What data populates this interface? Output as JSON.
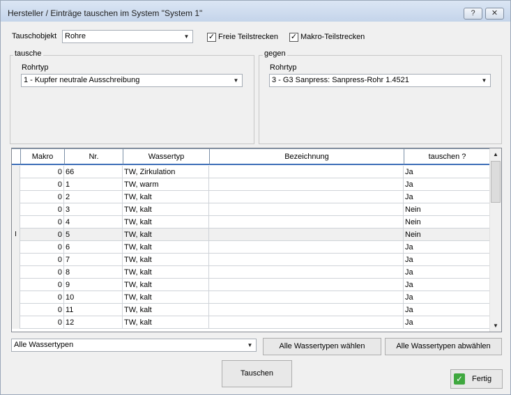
{
  "window": {
    "title": "Hersteller / Einträge tauschen im System \"System 1\"",
    "help_label": "?",
    "close_label": "✕"
  },
  "tauschobjekt": {
    "label": "Tauschobjekt",
    "value": "Rohre",
    "freie_label": "Freie Teilstrecken",
    "freie_checked": true,
    "makro_label": "Makro-Teilstrecken",
    "makro_checked": true
  },
  "tausche": {
    "legend": "tausche",
    "rohrtyp_label": "Rohrtyp",
    "rohrtyp_value": "1 - Kupfer neutrale Ausschreibung"
  },
  "gegen": {
    "legend": "gegen",
    "rohrtyp_label": "Rohrtyp",
    "rohrtyp_value": "3 - G3 Sanpress:  Sanpress-Rohr 1.4521"
  },
  "grid": {
    "columns": [
      "Makro",
      "Nr.",
      "Wassertyp",
      "Bezeichnung",
      "tauschen ?"
    ],
    "rows": [
      {
        "makro": "0",
        "nr": "66",
        "wassertyp": "TW, Zirkulation",
        "bezeichnung": "",
        "tauschen": "Ja"
      },
      {
        "makro": "0",
        "nr": "1",
        "wassertyp": "TW, warm",
        "bezeichnung": "",
        "tauschen": "Ja"
      },
      {
        "makro": "0",
        "nr": "2",
        "wassertyp": "TW, kalt",
        "bezeichnung": "",
        "tauschen": "Ja"
      },
      {
        "makro": "0",
        "nr": "3",
        "wassertyp": "TW, kalt",
        "bezeichnung": "",
        "tauschen": "Nein"
      },
      {
        "makro": "0",
        "nr": "4",
        "wassertyp": "TW, kalt",
        "bezeichnung": "",
        "tauschen": "Nein"
      },
      {
        "makro": "0",
        "nr": "5",
        "wassertyp": "TW, kalt",
        "bezeichnung": "",
        "tauschen": "Nein"
      },
      {
        "makro": "0",
        "nr": "6",
        "wassertyp": "TW, kalt",
        "bezeichnung": "",
        "tauschen": "Ja"
      },
      {
        "makro": "0",
        "nr": "7",
        "wassertyp": "TW, kalt",
        "bezeichnung": "",
        "tauschen": "Ja"
      },
      {
        "makro": "0",
        "nr": "8",
        "wassertyp": "TW, kalt",
        "bezeichnung": "",
        "tauschen": "Ja"
      },
      {
        "makro": "0",
        "nr": "9",
        "wassertyp": "TW, kalt",
        "bezeichnung": "",
        "tauschen": "Ja"
      },
      {
        "makro": "0",
        "nr": "10",
        "wassertyp": "TW, kalt",
        "bezeichnung": "",
        "tauschen": "Ja"
      },
      {
        "makro": "0",
        "nr": "11",
        "wassertyp": "TW, kalt",
        "bezeichnung": "",
        "tauschen": "Ja"
      },
      {
        "makro": "0",
        "nr": "12",
        "wassertyp": "TW, kalt",
        "bezeichnung": "",
        "tauschen": "Ja"
      }
    ]
  },
  "filter": {
    "value": "Alle Wassertypen",
    "select_all_label": "Alle Wassertypen wählen",
    "deselect_all_label": "Alle Wassertypen abwählen"
  },
  "actions": {
    "tauschen_label": "Tauschen",
    "fertig_label": "Fertig"
  }
}
